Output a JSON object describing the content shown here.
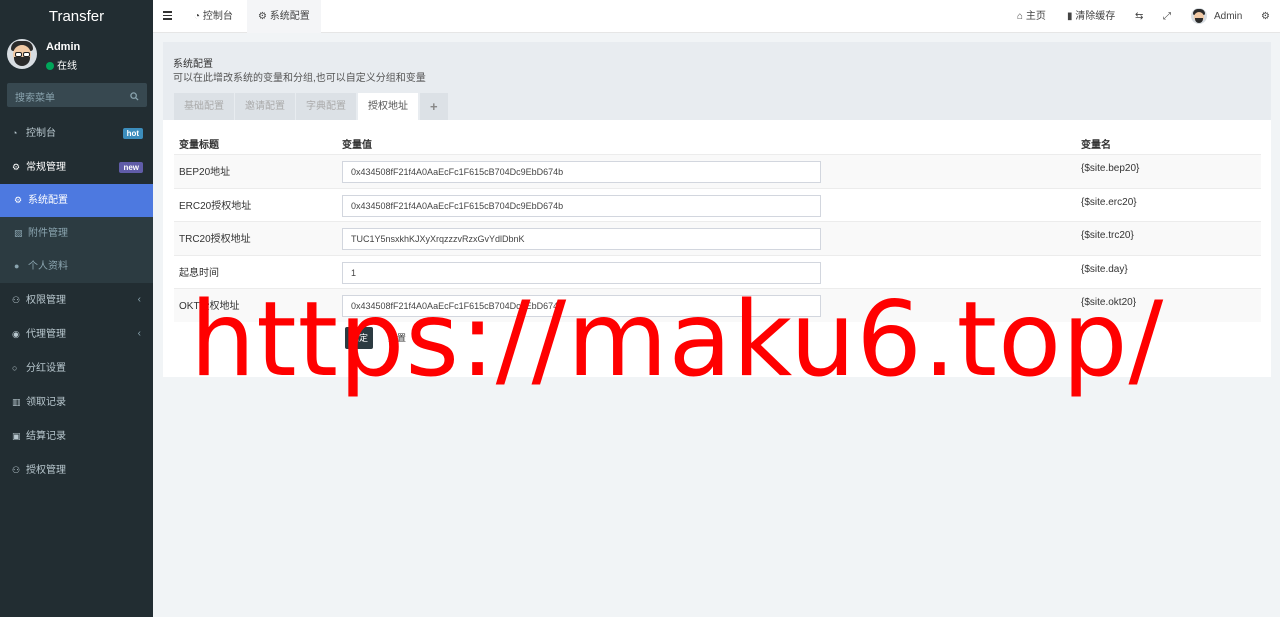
{
  "brand": "Transfer",
  "user": {
    "name": "Admin",
    "status": "在线"
  },
  "sidebar": {
    "search_placeholder": "搜索菜单",
    "items": [
      {
        "label": "控制台",
        "badge": "hot",
        "badge_color": "#3c8dbc"
      },
      {
        "label": "常规管理",
        "badge": "new",
        "badge_color": "#605ca8"
      },
      {
        "label": "系统配置"
      },
      {
        "label": "附件管理"
      },
      {
        "label": "个人资料"
      },
      {
        "label": "权限管理"
      },
      {
        "label": "代理管理"
      },
      {
        "label": "分红设置"
      },
      {
        "label": "领取记录"
      },
      {
        "label": "结算记录"
      },
      {
        "label": "授权管理"
      }
    ]
  },
  "header": {
    "tabs": [
      "控制台",
      "系统配置"
    ],
    "right": {
      "home": "主页",
      "clear_cache": "清除缓存",
      "user": "Admin"
    }
  },
  "panel": {
    "title": "系统配置",
    "subtitle": "可以在此增改系统的变量和分组,也可以自定义分组和变量",
    "tabs": [
      "基础配置",
      "邀请配置",
      "字典配置",
      "授权地址",
      "+"
    ],
    "columns": [
      "变量标题",
      "变量值",
      "变量名"
    ],
    "rows": [
      {
        "title": "BEP20地址",
        "value": "0x434508fF21f4A0AaEcFc1F615cB704Dc9EbD674b",
        "name": "{$site.bep20}"
      },
      {
        "title": "ERC20授权地址",
        "value": "0x434508fF21f4A0AaEcFc1F615cB704Dc9EbD674b",
        "name": "{$site.erc20}"
      },
      {
        "title": "TRC20授权地址",
        "value": "TUC1Y5nsxkhKJXyXrqzzzvRzxGvYdlDbnK",
        "name": "{$site.trc20}"
      },
      {
        "title": "起息时间",
        "value": "1",
        "name": "{$site.day}"
      },
      {
        "title": "OKT授权地址",
        "value": "0x434508fF21f4A0AaEcFc1F615cB704Dc9EbD674b",
        "name": "{$site.okt20}"
      }
    ],
    "ok_button": "确定",
    "reset_button": "重置"
  },
  "watermark": "https://maku6.top/"
}
